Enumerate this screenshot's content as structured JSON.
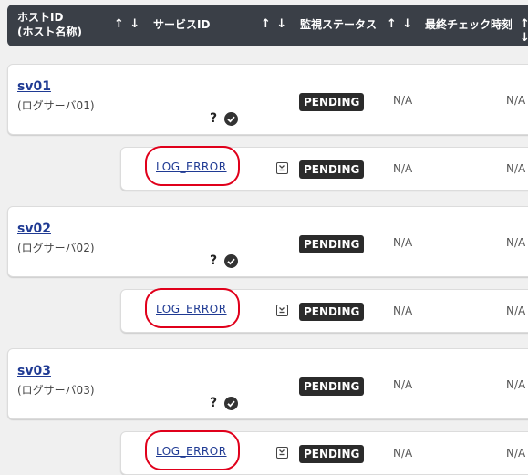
{
  "header": {
    "host_id_line1": "ホストID",
    "host_id_line2": "(ホスト名称)",
    "service_id": "サービスID",
    "status": "監視ステータス",
    "last_check": "最終チェック時刻",
    "sort_arrows": "↑ ↓"
  },
  "rows": [
    {
      "host_id": "sv01",
      "host_name": "(ログサーバ01)",
      "host_status": "PENDING",
      "host_na1": "N/A",
      "host_na2": "N/A",
      "service_id": "LOG_ERROR",
      "service_status": "PENDING",
      "service_na1": "N/A",
      "service_na2": "N/A"
    },
    {
      "host_id": "sv02",
      "host_name": "(ログサーバ02)",
      "host_status": "PENDING",
      "host_na1": "N/A",
      "host_na2": "N/A",
      "service_id": "LOG_ERROR",
      "service_status": "PENDING",
      "service_na1": "N/A",
      "service_na2": "N/A"
    },
    {
      "host_id": "sv03",
      "host_name": "(ログサーバ03)",
      "host_status": "PENDING",
      "host_na1": "N/A",
      "host_na2": "N/A",
      "service_id": "LOG_ERROR",
      "service_status": "PENDING",
      "service_na1": "N/A",
      "service_na2": "N/A"
    }
  ],
  "icons": {
    "help": "?",
    "ok": "check-circle-icon",
    "expand": "collapse-down-icon"
  },
  "colors": {
    "header_bg": "#3a3f47",
    "badge_bg": "#2b2b2b",
    "link": "#1f3a93",
    "highlight": "#e0001b"
  }
}
